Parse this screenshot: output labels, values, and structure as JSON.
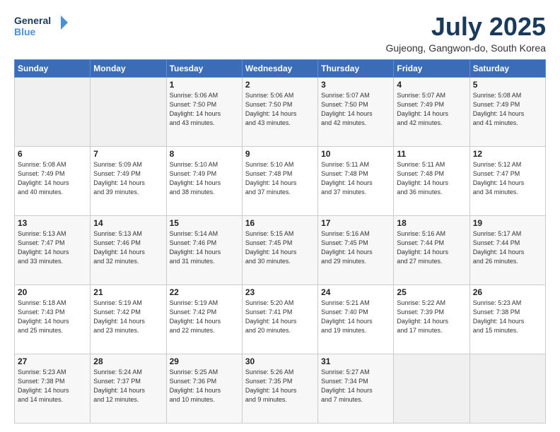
{
  "header": {
    "logo_line1": "General",
    "logo_line2": "Blue",
    "month": "July 2025",
    "location": "Gujeong, Gangwon-do, South Korea"
  },
  "weekdays": [
    "Sunday",
    "Monday",
    "Tuesday",
    "Wednesday",
    "Thursday",
    "Friday",
    "Saturday"
  ],
  "weeks": [
    [
      {
        "day": "",
        "info": ""
      },
      {
        "day": "",
        "info": ""
      },
      {
        "day": "1",
        "info": "Sunrise: 5:06 AM\nSunset: 7:50 PM\nDaylight: 14 hours\nand 43 minutes."
      },
      {
        "day": "2",
        "info": "Sunrise: 5:06 AM\nSunset: 7:50 PM\nDaylight: 14 hours\nand 43 minutes."
      },
      {
        "day": "3",
        "info": "Sunrise: 5:07 AM\nSunset: 7:50 PM\nDaylight: 14 hours\nand 42 minutes."
      },
      {
        "day": "4",
        "info": "Sunrise: 5:07 AM\nSunset: 7:49 PM\nDaylight: 14 hours\nand 42 minutes."
      },
      {
        "day": "5",
        "info": "Sunrise: 5:08 AM\nSunset: 7:49 PM\nDaylight: 14 hours\nand 41 minutes."
      }
    ],
    [
      {
        "day": "6",
        "info": "Sunrise: 5:08 AM\nSunset: 7:49 PM\nDaylight: 14 hours\nand 40 minutes."
      },
      {
        "day": "7",
        "info": "Sunrise: 5:09 AM\nSunset: 7:49 PM\nDaylight: 14 hours\nand 39 minutes."
      },
      {
        "day": "8",
        "info": "Sunrise: 5:10 AM\nSunset: 7:49 PM\nDaylight: 14 hours\nand 38 minutes."
      },
      {
        "day": "9",
        "info": "Sunrise: 5:10 AM\nSunset: 7:48 PM\nDaylight: 14 hours\nand 37 minutes."
      },
      {
        "day": "10",
        "info": "Sunrise: 5:11 AM\nSunset: 7:48 PM\nDaylight: 14 hours\nand 37 minutes."
      },
      {
        "day": "11",
        "info": "Sunrise: 5:11 AM\nSunset: 7:48 PM\nDaylight: 14 hours\nand 36 minutes."
      },
      {
        "day": "12",
        "info": "Sunrise: 5:12 AM\nSunset: 7:47 PM\nDaylight: 14 hours\nand 34 minutes."
      }
    ],
    [
      {
        "day": "13",
        "info": "Sunrise: 5:13 AM\nSunset: 7:47 PM\nDaylight: 14 hours\nand 33 minutes."
      },
      {
        "day": "14",
        "info": "Sunrise: 5:13 AM\nSunset: 7:46 PM\nDaylight: 14 hours\nand 32 minutes."
      },
      {
        "day": "15",
        "info": "Sunrise: 5:14 AM\nSunset: 7:46 PM\nDaylight: 14 hours\nand 31 minutes."
      },
      {
        "day": "16",
        "info": "Sunrise: 5:15 AM\nSunset: 7:45 PM\nDaylight: 14 hours\nand 30 minutes."
      },
      {
        "day": "17",
        "info": "Sunrise: 5:16 AM\nSunset: 7:45 PM\nDaylight: 14 hours\nand 29 minutes."
      },
      {
        "day": "18",
        "info": "Sunrise: 5:16 AM\nSunset: 7:44 PM\nDaylight: 14 hours\nand 27 minutes."
      },
      {
        "day": "19",
        "info": "Sunrise: 5:17 AM\nSunset: 7:44 PM\nDaylight: 14 hours\nand 26 minutes."
      }
    ],
    [
      {
        "day": "20",
        "info": "Sunrise: 5:18 AM\nSunset: 7:43 PM\nDaylight: 14 hours\nand 25 minutes."
      },
      {
        "day": "21",
        "info": "Sunrise: 5:19 AM\nSunset: 7:42 PM\nDaylight: 14 hours\nand 23 minutes."
      },
      {
        "day": "22",
        "info": "Sunrise: 5:19 AM\nSunset: 7:42 PM\nDaylight: 14 hours\nand 22 minutes."
      },
      {
        "day": "23",
        "info": "Sunrise: 5:20 AM\nSunset: 7:41 PM\nDaylight: 14 hours\nand 20 minutes."
      },
      {
        "day": "24",
        "info": "Sunrise: 5:21 AM\nSunset: 7:40 PM\nDaylight: 14 hours\nand 19 minutes."
      },
      {
        "day": "25",
        "info": "Sunrise: 5:22 AM\nSunset: 7:39 PM\nDaylight: 14 hours\nand 17 minutes."
      },
      {
        "day": "26",
        "info": "Sunrise: 5:23 AM\nSunset: 7:38 PM\nDaylight: 14 hours\nand 15 minutes."
      }
    ],
    [
      {
        "day": "27",
        "info": "Sunrise: 5:23 AM\nSunset: 7:38 PM\nDaylight: 14 hours\nand 14 minutes."
      },
      {
        "day": "28",
        "info": "Sunrise: 5:24 AM\nSunset: 7:37 PM\nDaylight: 14 hours\nand 12 minutes."
      },
      {
        "day": "29",
        "info": "Sunrise: 5:25 AM\nSunset: 7:36 PM\nDaylight: 14 hours\nand 10 minutes."
      },
      {
        "day": "30",
        "info": "Sunrise: 5:26 AM\nSunset: 7:35 PM\nDaylight: 14 hours\nand 9 minutes."
      },
      {
        "day": "31",
        "info": "Sunrise: 5:27 AM\nSunset: 7:34 PM\nDaylight: 14 hours\nand 7 minutes."
      },
      {
        "day": "",
        "info": ""
      },
      {
        "day": "",
        "info": ""
      }
    ]
  ]
}
